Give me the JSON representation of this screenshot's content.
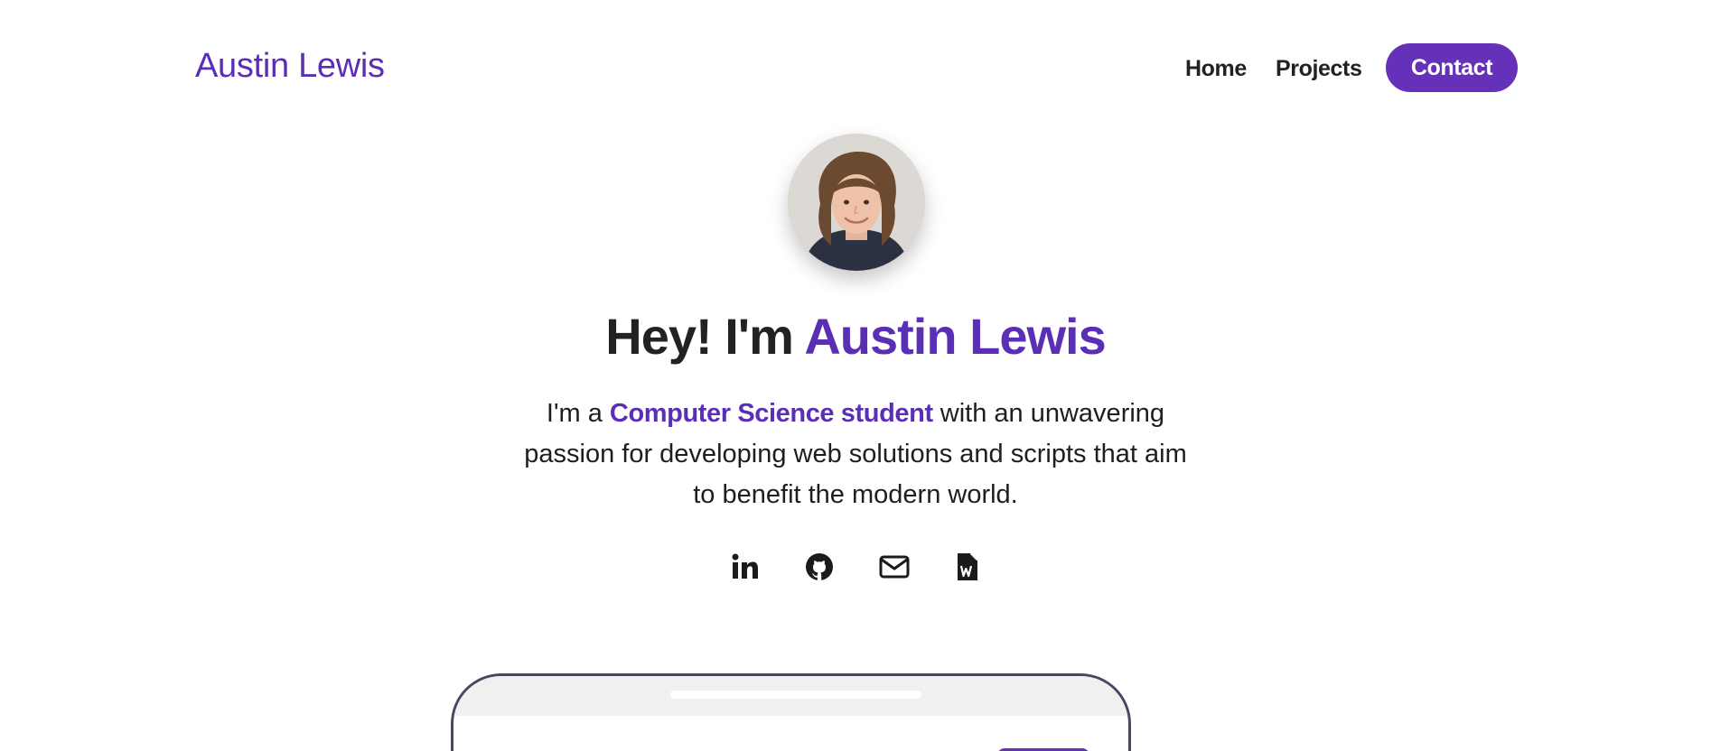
{
  "nav": {
    "brand": "Austin Lewis",
    "links": [
      {
        "label": "Home"
      },
      {
        "label": "Projects"
      }
    ],
    "contact_label": "Contact"
  },
  "hero": {
    "avatar_alt": "Austin Lewis",
    "headline_prefix": "Hey! I'm ",
    "headline_name": "Austin Lewis",
    "intro_prefix": "I'm a ",
    "intro_highlight": "Computer Science student",
    "intro_suffix": " with an unwavering passion for developing web solutions and scripts that aim to benefit the modern world."
  },
  "socials": [
    {
      "icon": "linkedin-icon"
    },
    {
      "icon": "github-icon"
    },
    {
      "icon": "mail-icon"
    },
    {
      "icon": "resume-doc-icon"
    }
  ],
  "colors": {
    "accent": "#5b2fb5",
    "button": "#6431b8",
    "text": "#222222",
    "background": "#ffffff"
  }
}
